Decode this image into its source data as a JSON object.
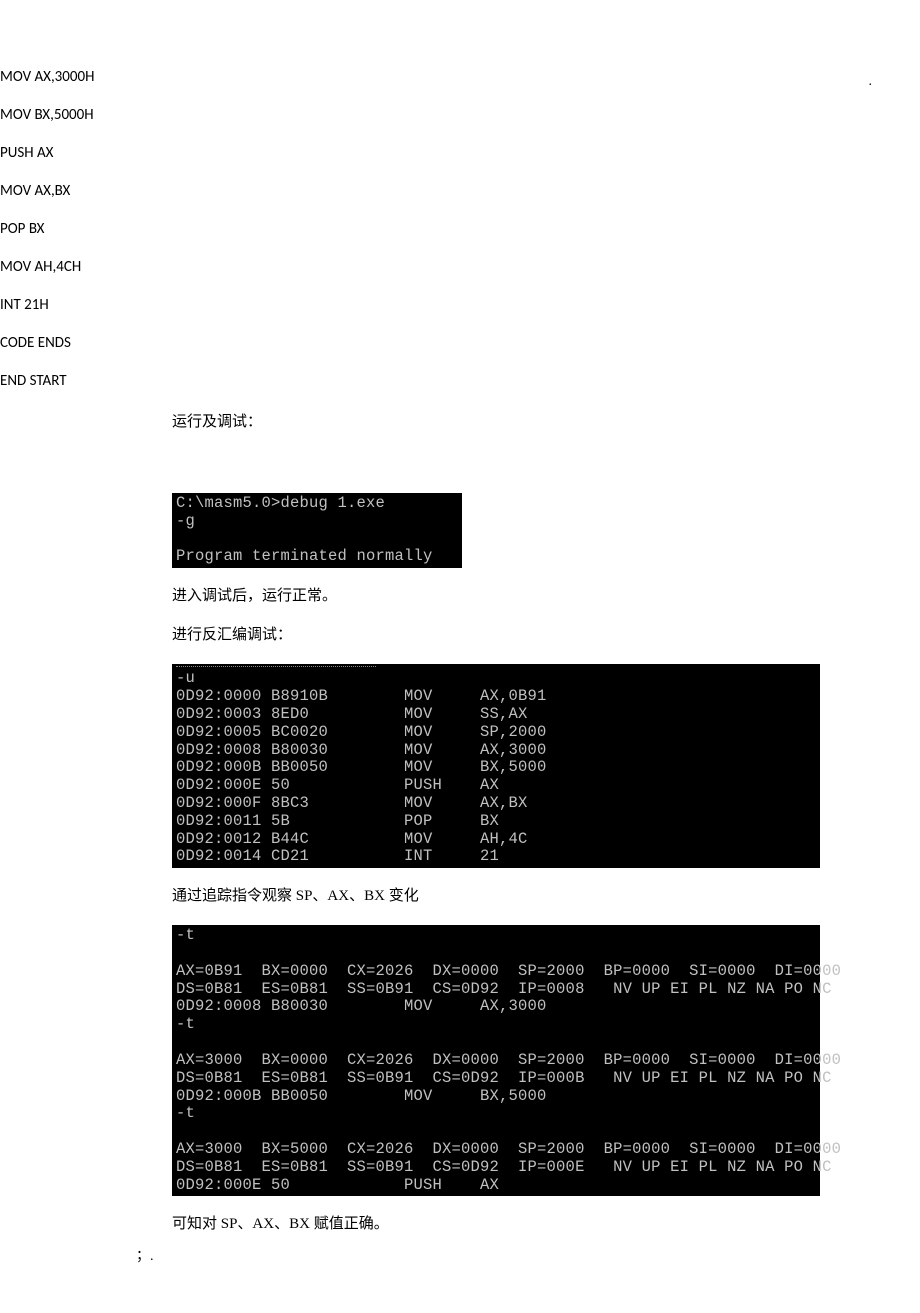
{
  "src": {
    "l1": "MOV AX,3000H",
    "l2": "MOV BX,5000H",
    "l3": "PUSH AX",
    "l4": "MOV AX,BX",
    "l5": "POP BX",
    "l6": "MOV AH,4CH",
    "l7": "INT 21H",
    "ends": "CODE ENDS",
    "end": "END START"
  },
  "text": {
    "run_debug": "运行及调试：",
    "enter_ok": "进入调试后，运行正常。",
    "disasm": "进行反汇编调试：",
    "trace": "通过追踪指令观察 SP、AX、BX 变化",
    "result": "可知对 SP、AX、BX 赋值正确。",
    "dot_top": ".",
    "dot_bottom": "；."
  },
  "terminal1": {
    "l1": "C:\\masm5.0>debug 1.exe",
    "l2": "-g",
    "l3": "",
    "l4": "Program terminated normally"
  },
  "terminal2": {
    "cmd": "-u",
    "rows": [
      {
        "addr": "0D92:0000",
        "bytes": "B8910B",
        "mn": "MOV",
        "ops": "AX,0B91"
      },
      {
        "addr": "0D92:0003",
        "bytes": "8ED0",
        "mn": "MOV",
        "ops": "SS,AX"
      },
      {
        "addr": "0D92:0005",
        "bytes": "BC0020",
        "mn": "MOV",
        "ops": "SP,2000"
      },
      {
        "addr": "0D92:0008",
        "bytes": "B80030",
        "mn": "MOV",
        "ops": "AX,3000"
      },
      {
        "addr": "0D92:000B",
        "bytes": "BB0050",
        "mn": "MOV",
        "ops": "BX,5000"
      },
      {
        "addr": "0D92:000E",
        "bytes": "50",
        "mn": "PUSH",
        "ops": "AX"
      },
      {
        "addr": "0D92:000F",
        "bytes": "8BC3",
        "mn": "MOV",
        "ops": "AX,BX"
      },
      {
        "addr": "0D92:0011",
        "bytes": "5B",
        "mn": "POP",
        "ops": "BX"
      },
      {
        "addr": "0D92:0012",
        "bytes": "B44C",
        "mn": "MOV",
        "ops": "AH,4C"
      },
      {
        "addr": "0D92:0014",
        "bytes": "CD21",
        "mn": "INT",
        "ops": "21"
      }
    ]
  },
  "terminal3": {
    "blocks": [
      {
        "cmd": "-t",
        "regs1": "AX=0B91  BX=0000  CX=2026  DX=0000  SP=2000  BP=0000  SI=0000  DI=0000",
        "regs2": "DS=0B81  ES=0B81  SS=0B91  CS=0D92  IP=0008   NV UP EI PL NZ NA PO NC",
        "instr": "0D92:0008 B80030        MOV     AX,3000",
        "after": "-t"
      },
      {
        "cmd": "",
        "regs1": "AX=3000  BX=0000  CX=2026  DX=0000  SP=2000  BP=0000  SI=0000  DI=0000",
        "regs2": "DS=0B81  ES=0B81  SS=0B91  CS=0D92  IP=000B   NV UP EI PL NZ NA PO NC",
        "instr": "0D92:000B BB0050        MOV     BX,5000",
        "after": "-t"
      },
      {
        "cmd": "",
        "regs1": "AX=3000  BX=5000  CX=2026  DX=0000  SP=2000  BP=0000  SI=0000  DI=0000",
        "regs2": "DS=0B81  ES=0B81  SS=0B91  CS=0D92  IP=000E   NV UP EI PL NZ NA PO NC",
        "instr": "0D92:000E 50            PUSH    AX",
        "after": ""
      }
    ]
  }
}
